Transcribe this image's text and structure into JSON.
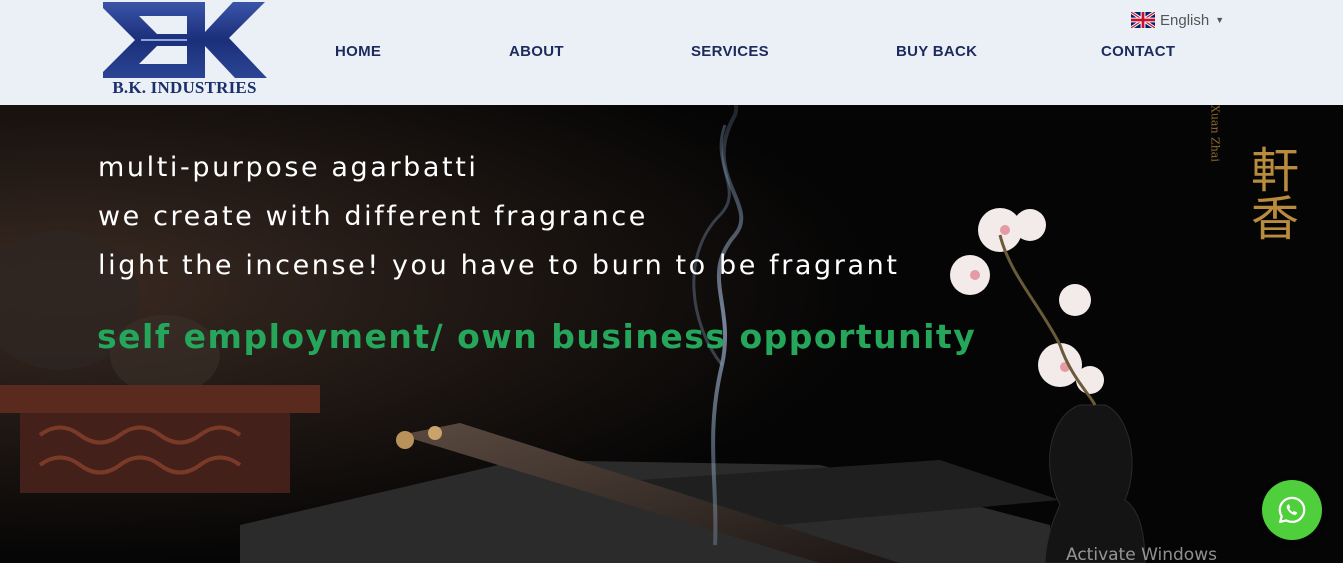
{
  "brand": {
    "name": "B.K. INDUSTRIES",
    "logo_icon": "ek-logo-icon",
    "color": "#1a2f6b"
  },
  "nav": {
    "items": [
      {
        "label": "HOME"
      },
      {
        "label": "ABOUT"
      },
      {
        "label": "SERVICES"
      },
      {
        "label": "BUY BACK"
      },
      {
        "label": "CONTACT"
      }
    ],
    "color": "#1d2b5c"
  },
  "language": {
    "label": "English",
    "flag_icon": "uk-flag-icon",
    "caret_icon": "caret-down-icon"
  },
  "hero": {
    "lines": [
      "multi-purpose agarbatti",
      "we create with different fragrance",
      "light the incense! you have to burn to be fragrant"
    ],
    "cta": "self employment/ own business opportunity",
    "cta_color": "#26a65b",
    "side_text_vertical": "Xuan Zhai",
    "side_text_chinese": "軒香"
  },
  "system": {
    "watermark": "Activate Windows"
  },
  "whatsapp": {
    "icon": "whatsapp-icon",
    "color": "#4fcf3b"
  }
}
